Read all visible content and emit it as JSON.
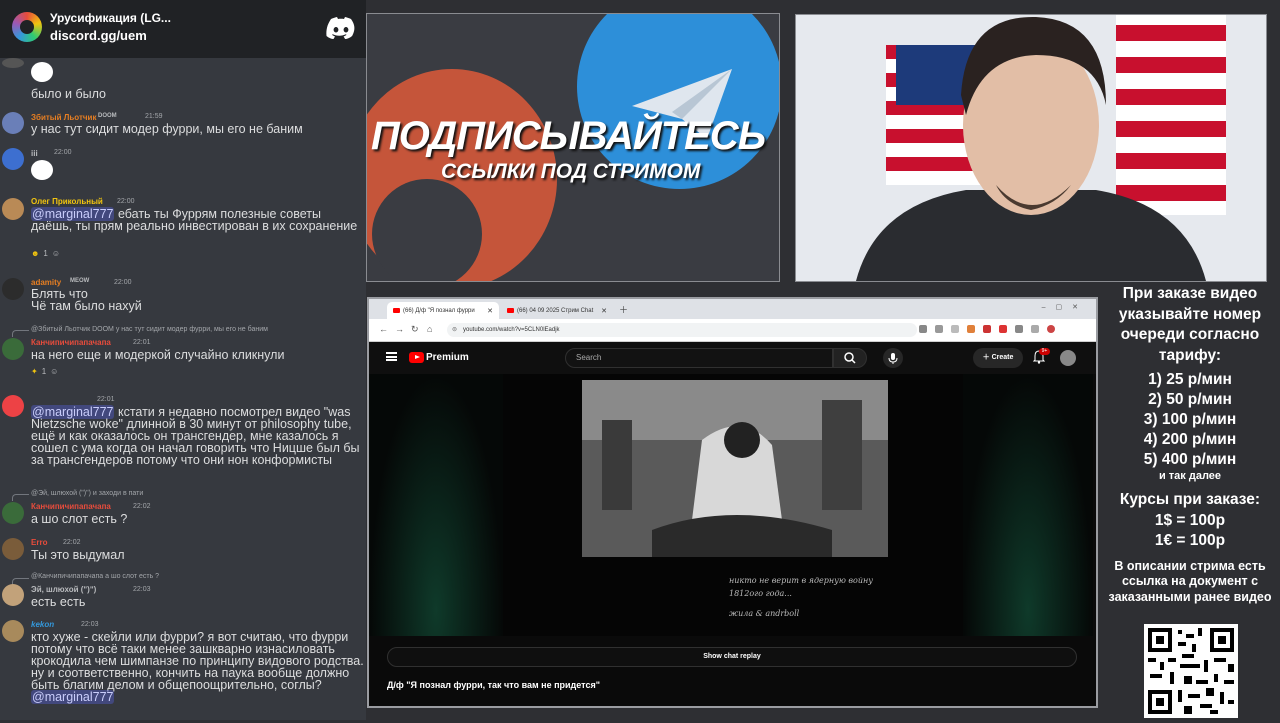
{
  "server": {
    "name": "Урусификация (LG...",
    "invite": "discord.gg/uem"
  },
  "messages": [
    {
      "text": "было и было"
    },
    {
      "user": "Збитый Льотчик",
      "badge": "DOOM",
      "time": "21:59",
      "text": "у нас тут сидит модер фурри, мы его не баним"
    },
    {
      "user": "iii",
      "time": "22:00"
    },
    {
      "user": "Олег Прикольный",
      "time": "22:00",
      "mention": "@marginal777",
      "text": " ебать ты Фуррям полезные советы даёшь, ты прям реально инвестирован в их сохранение",
      "reaction_count": "1"
    },
    {
      "user": "adamity",
      "badge": "MEOW",
      "time": "22:00",
      "text": "Блять что\nЧё там было нахуй"
    },
    {
      "reply": "@Збитый Льотчик DOOM у нас тут сидит модер фурри, мы его не баним",
      "user": "Канчипичипапачапа",
      "time": "22:01",
      "text": "на него еще и модеркой случайно кликнули",
      "reaction_count": "1"
    },
    {
      "user": "",
      "time": "22:01",
      "mention": "@marginal777",
      "text": " кстати я недавно посмотрел видео \"was Nietzsche woke\" длинной в 30 минут от philosophy tube, ещё и как оказалось он трансгендер, мне казалось я сошел с ума когда он начал говорить что Ницше был бы за трансгендеров потому что они нон конформисты"
    },
    {
      "reply": "@Эй, шлюхой (ʺ)ʺ) и заходи в пати",
      "user": "Канчипичипапачапа",
      "time": "22:02",
      "text": "а шо слот есть ?"
    },
    {
      "user": "Erro",
      "time": "22:02",
      "text": "Ты это выдумал"
    },
    {
      "reply": "@Канчипичипапачапа а шо слот есть ?",
      "user": "Эй, шлюхой (ʺ)ʺ)",
      "time": "22:03",
      "text": "есть есть"
    },
    {
      "user": "kekon",
      "time": "22:03",
      "text": "кто хуже - скейли или фурри? я вот считаю, что фурри потому что всё таки менее зашкварно изнасиловать крокодила чем шимпанзе по принципу видового родства. ну и соответственно, кончить на паука вообще должно быть благим делом и общепоощрительно, соглы? ",
      "mention": "@marginal777"
    }
  ],
  "promo": {
    "title": "ПОДПИСЫВАЙТЕСЬ",
    "subtitle": "ССЫЛКИ ПОД СТРИМОМ"
  },
  "browser": {
    "tabs": [
      "(66) Д/ф \"Я познал фурри",
      "(66) 04 09 2025 Стрим Chat"
    ],
    "url": "youtube.com/watch?v=5CLN0lEadjk"
  },
  "youtube": {
    "brand": "Premium",
    "search_placeholder": "Search",
    "create_label": "Create",
    "notifications": "9+",
    "caption_line1": "никто не верит в ядерную войну",
    "caption_line2": "1812ого года...",
    "caption_line3": "жила & andrboll",
    "chat_replay_label": "Show chat replay",
    "video_title": "Д/ф \"Я познал фурри, так что вам не придется\""
  },
  "info": {
    "heading": "При заказе видео указывайте номер очереди согласно тарифу:",
    "tariffs": [
      "1) 25 р/мин",
      "2) 50 р/мин",
      "3) 100 р/мин",
      "4) 200 р/мин",
      "5) 400 р/мин"
    ],
    "more": "и так далее",
    "rates_heading": "Курсы при заказе:",
    "rates": [
      "1$ = 100р",
      "1€ = 100р"
    ],
    "doc_note": "В описании стрима есть ссылка на документ с заказанными ранее видео"
  },
  "colors": {
    "discord_bg": "#36393f",
    "mention": "#5865f2",
    "youtube_red": "#ff0000",
    "telegram_blue": "#2d8fd9",
    "patreon_red": "#c5553a"
  }
}
